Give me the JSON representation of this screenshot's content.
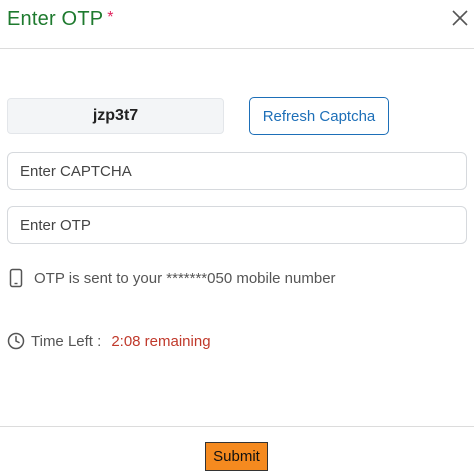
{
  "dialog": {
    "title": "Enter OTP",
    "required_marker": "*"
  },
  "captcha": {
    "code": "jzp3t7",
    "refresh_label": "Refresh Captcha",
    "input_placeholder": "Enter CAPTCHA"
  },
  "otp": {
    "input_placeholder": "Enter OTP",
    "sent_message": "OTP is sent to your *******050 mobile number"
  },
  "timer": {
    "label": "Time Left :",
    "remaining": "2:08 remaining"
  },
  "footer": {
    "submit_label": "Submit"
  },
  "colors": {
    "title": "#1e7a2e",
    "accent": "#1d6fb8",
    "submit": "#f58a1f",
    "warning": "#c0392b"
  },
  "icons": {
    "close": "close-icon",
    "phone": "mobile-phone-icon",
    "clock": "clock-icon"
  }
}
